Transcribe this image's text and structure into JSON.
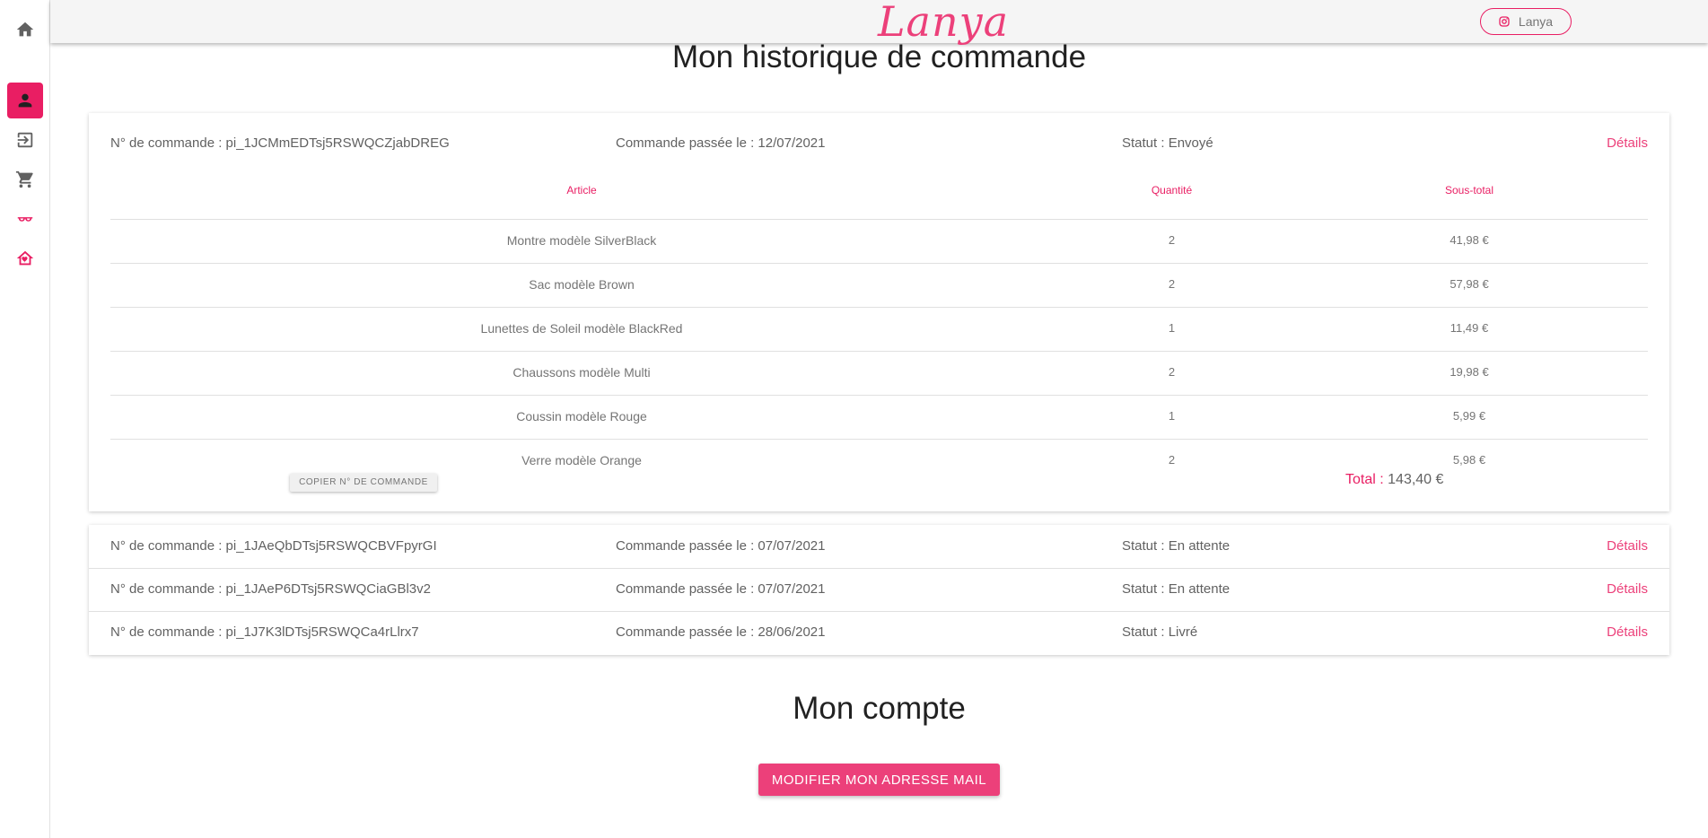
{
  "app": {
    "logo": "Lanya",
    "instagram_label": "Lanya"
  },
  "sidebar": {
    "items": [
      {
        "icon": "home-icon"
      },
      {
        "icon": "account-icon",
        "active": true
      },
      {
        "icon": "logout-icon"
      },
      {
        "icon": "cart-icon"
      },
      {
        "icon": "glasses-icon"
      },
      {
        "icon": "home-heart-icon"
      }
    ]
  },
  "history": {
    "title": "Mon historique de commande",
    "orders": [
      {
        "number": "N° de commande : pi_1JCMmEDTsj5RSWQCZjabDREG",
        "date": "Commande passée le : 12/07/2021",
        "status": "Statut : Envoyé",
        "details": "Détails",
        "expanded": true,
        "headers": {
          "article": "Article",
          "quantity": "Quantité",
          "subtotal": "Sous-total"
        },
        "items": [
          {
            "article": "Montre modèle SilverBlack",
            "quantity": "2",
            "subtotal": "41,98 €"
          },
          {
            "article": "Sac modèle Brown",
            "quantity": "2",
            "subtotal": "57,98 €"
          },
          {
            "article": "Lunettes de Soleil modèle BlackRed",
            "quantity": "1",
            "subtotal": "11,49 €"
          },
          {
            "article": "Chaussons modèle Multi",
            "quantity": "2",
            "subtotal": "19,98 €"
          },
          {
            "article": "Coussin modèle Rouge",
            "quantity": "1",
            "subtotal": "5,99 €"
          },
          {
            "article": "Verre modèle Orange",
            "quantity": "2",
            "subtotal": "5,98 €"
          }
        ],
        "copy_label": "COPIER N° DE COMMANDE",
        "total_label": "Total :",
        "total_value": "143,40 €"
      },
      {
        "number": "N° de commande : pi_1JAeQbDTsj5RSWQCBVFpyrGI",
        "date": "Commande passée le : 07/07/2021",
        "status": "Statut : En attente",
        "details": "Détails"
      },
      {
        "number": "N° de commande : pi_1JAeP6DTsj5RSWQCiaGBl3v2",
        "date": "Commande passée le : 07/07/2021",
        "status": "Statut : En attente",
        "details": "Détails"
      },
      {
        "number": "N° de commande : pi_1J7K3lDTsj5RSWQCa4rLlrx7",
        "date": "Commande passée le : 28/06/2021",
        "status": "Statut : Livré",
        "details": "Détails"
      }
    ]
  },
  "account": {
    "title": "Mon compte",
    "change_email_label": "MODIFIER MON ADRESSE MAIL"
  },
  "colors": {
    "accent": "#e91e63",
    "accent_light": "#ec407a",
    "text": "#616161"
  }
}
